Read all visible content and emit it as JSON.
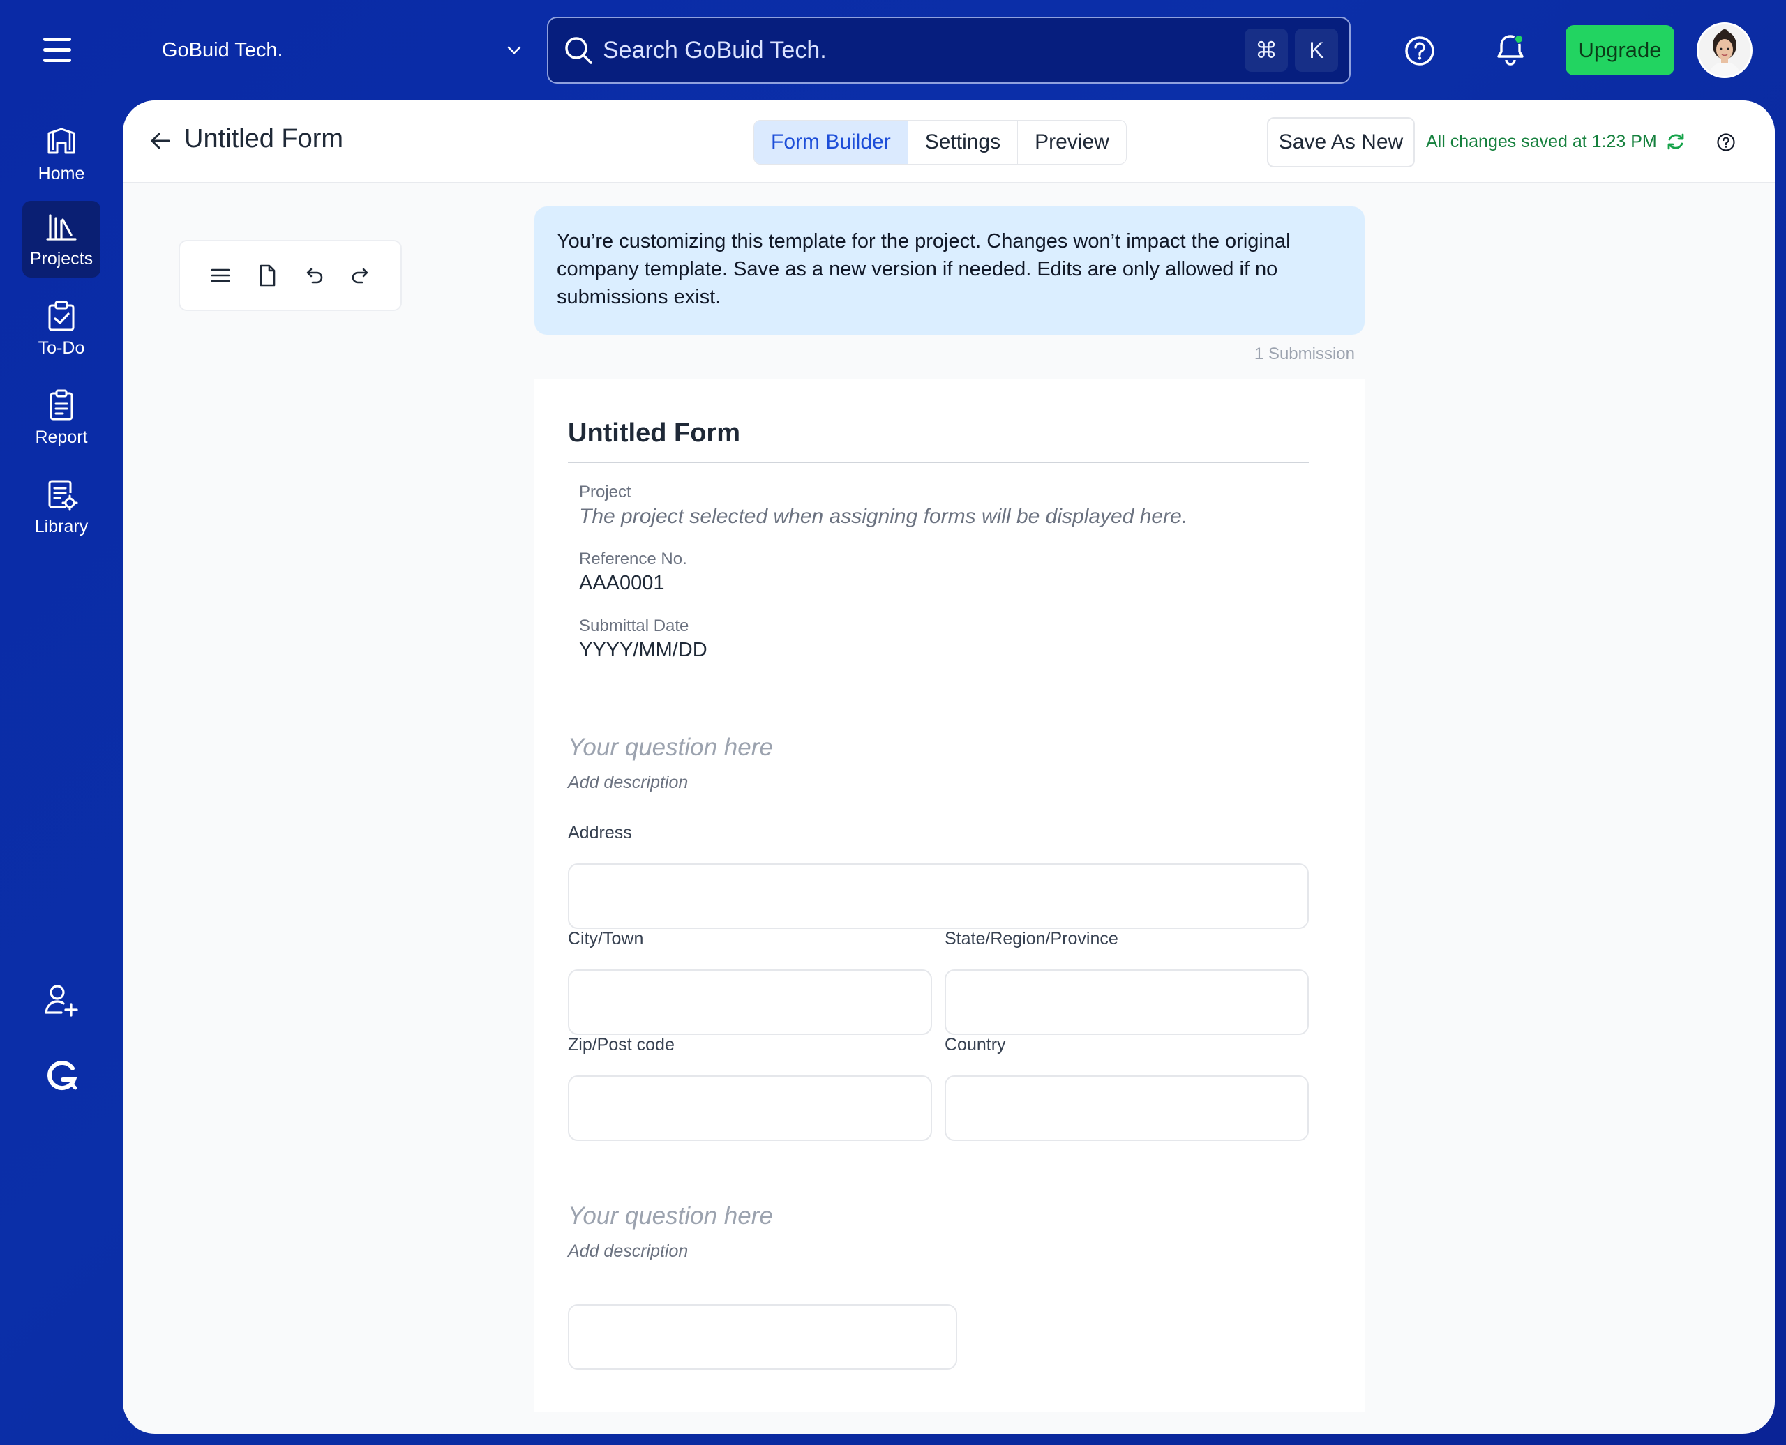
{
  "topbar": {
    "org_name": "GoBuid Tech.",
    "search_placeholder": "Search GoBuid Tech.",
    "shortcut_keys": [
      "⌘",
      "K"
    ],
    "upgrade_label": "Upgrade"
  },
  "nav": {
    "items": [
      {
        "label": "Home",
        "icon": "home-icon",
        "active": false
      },
      {
        "label": "Projects",
        "icon": "projects-icon",
        "active": true
      },
      {
        "label": "To-Do",
        "icon": "todo-icon",
        "active": false
      },
      {
        "label": "Report",
        "icon": "report-icon",
        "active": false
      },
      {
        "label": "Library",
        "icon": "library-icon",
        "active": false
      }
    ],
    "bottom_icons": [
      "add-user-icon",
      "gobuild-logo-icon"
    ]
  },
  "header": {
    "title": "Untitled Form",
    "tabs": [
      {
        "label": "Form Builder",
        "active": true
      },
      {
        "label": "Settings",
        "active": false
      },
      {
        "label": "Preview",
        "active": false
      }
    ],
    "save_as_new_label": "Save As New",
    "saved_status": "All changes saved at 1:23 PM"
  },
  "toolbar": [
    "menu-icon",
    "document-icon",
    "undo-icon",
    "redo-icon"
  ],
  "banner": {
    "text": "You’re customizing this template for the project. Changes won’t impact the original company template. Save as a new version if needed. Edits are only allowed if no submissions exist."
  },
  "submissions_count": "1 Submission",
  "form": {
    "title": "Untitled Form",
    "meta": {
      "project_label": "Project",
      "project_placeholder": "The project selected when assigning forms will be displayed here.",
      "reference_label": "Reference No.",
      "reference_value": "AAA0001",
      "date_label": "Submittal Date",
      "date_value": "YYYY/MM/DD"
    },
    "questions": [
      {
        "title": "Your question here",
        "description": "Add description",
        "fields": {
          "address": "Address",
          "city": "City/Town",
          "state": "State/Region/Province",
          "zip": "Zip/Post code",
          "country": "Country"
        }
      },
      {
        "title": "Your question here",
        "description": "Add description"
      }
    ]
  },
  "colors": {
    "brand_blue": "#0b2fa8",
    "upgrade_green": "#22d461",
    "active_tab_bg": "#dbeafe",
    "banner_bg": "#dbeeff",
    "saved_green": "#15803d"
  }
}
